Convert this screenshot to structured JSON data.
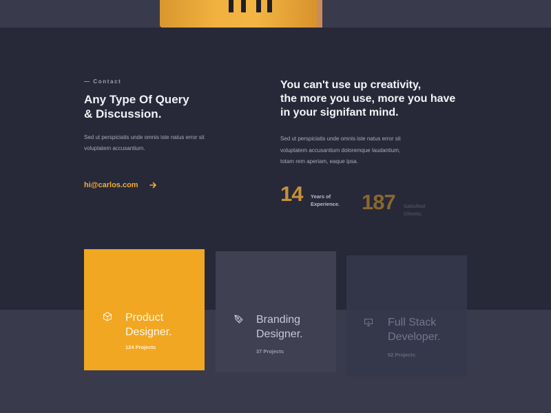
{
  "contact": {
    "label": "— Contact",
    "title_line1": "Any Type Of Query",
    "title_line2": "& Discussion.",
    "description": "Sed ut perspiciatis unde omnis iste natus error sit voluptatem accusantium.",
    "email": "hi@carlos.com"
  },
  "about": {
    "quote_line1": "You can't use up creativity,",
    "quote_line2": "the more you use, more you have",
    "quote_line3": "in your signifant mind.",
    "description": "Sed ut perspiciatis unde omnis iste natus error sit voluptatem accusantium doloremque laudantium, totam rem aperiam, eaque ipsa."
  },
  "stats": [
    {
      "number": "14",
      "label_line1": "Years of",
      "label_line2": "Experience.",
      "label_color": "#b9bccb",
      "number_color": "#c89138"
    },
    {
      "number": "187",
      "label_line1": "Satisfied",
      "label_line2": "Clients.",
      "label_color": "#4b4e62",
      "number_color": "#8a6730"
    }
  ],
  "services": [
    {
      "title_line1": "Product",
      "title_line2": "Designer.",
      "count": "124 Projects",
      "icon": "cube-icon"
    },
    {
      "title_line1": "Branding",
      "title_line2": "Designer.",
      "count": "37 Projects",
      "icon": "pen-tool-icon"
    },
    {
      "title_line1": "Full Stack",
      "title_line2": "Developer.",
      "count": "62 Projects",
      "icon": "monitor-icon"
    }
  ],
  "colors": {
    "background": "#272938",
    "band": "#393b4c",
    "accent": "#f2a722"
  }
}
